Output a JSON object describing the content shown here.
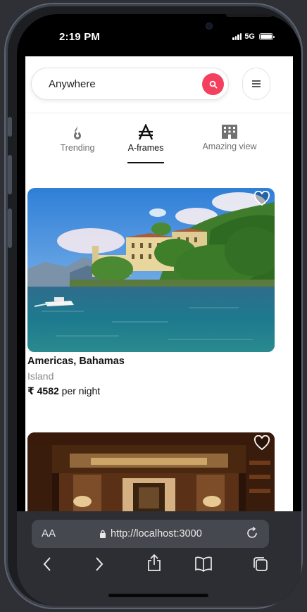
{
  "status": {
    "time": "2:19 PM",
    "network": "5G"
  },
  "search": {
    "text": "Anywhere"
  },
  "categories": [
    {
      "label": "Trending",
      "icon": "flame-icon",
      "active": false
    },
    {
      "label": "A-frames",
      "icon": "a-frame-icon",
      "active": true
    },
    {
      "label": "Amazing view",
      "icon": "building-icon",
      "active": false
    }
  ],
  "listings": [
    {
      "location": "Americas, Bahamas",
      "type": "Island",
      "price": "₹ 4582",
      "per": "per night"
    }
  ],
  "browser": {
    "aa_label": "AA",
    "url": "http://localhost:3000"
  },
  "colors": {
    "accent": "#f43f5e",
    "frame": "#1c1e22",
    "browser_bg": "#2c2e33"
  }
}
